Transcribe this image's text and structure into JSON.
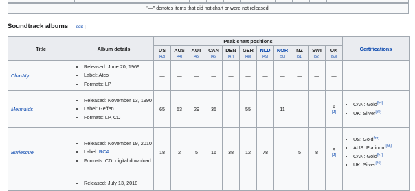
{
  "previous_note": "\"—\" denotes items that did not chart or were not released.",
  "section": {
    "title": "Soundtrack albums",
    "edit_label": "edit"
  },
  "headers": {
    "title": "Title",
    "album_details": "Album details",
    "peak": "Peak chart positions",
    "certifications": "Certifications",
    "countries": [
      {
        "code": "US",
        "ref": "[43]",
        "link": false
      },
      {
        "code": "AUS",
        "ref": "[44]",
        "link": false
      },
      {
        "code": "AUT",
        "ref": "[45]",
        "link": false
      },
      {
        "code": "CAN",
        "ref": "[46]",
        "link": false
      },
      {
        "code": "DEN",
        "ref": "[47]",
        "link": false
      },
      {
        "code": "GER",
        "ref": "[48]",
        "link": false
      },
      {
        "code": "NLD",
        "ref": "[49]",
        "link": true
      },
      {
        "code": "NOR",
        "ref": "[50]",
        "link": true
      },
      {
        "code": "NZ",
        "ref": "[51]",
        "link": false
      },
      {
        "code": "SWI",
        "ref": "[52]",
        "link": false
      },
      {
        "code": "UK",
        "ref": "[53]",
        "link": false
      }
    ]
  },
  "rows": [
    {
      "title": "Chastity",
      "details": [
        {
          "label": "Released:",
          "value": "June 20, 1969"
        },
        {
          "label": "Label:",
          "value": "Atco"
        },
        {
          "label": "Formats:",
          "value": "LP"
        }
      ],
      "peaks": [
        "—",
        "—",
        "—",
        "—",
        "—",
        "—",
        "—",
        "—",
        "—",
        "—",
        "—"
      ],
      "uk_ref": "",
      "certs": []
    },
    {
      "title": "Mermaids",
      "details": [
        {
          "label": "Released:",
          "value": "November 13, 1990"
        },
        {
          "label": "Label:",
          "value": "Geffen"
        },
        {
          "label": "Formats:",
          "value": "LP, CD"
        }
      ],
      "peaks": [
        "65",
        "53",
        "29",
        "35",
        "—",
        "55",
        "—",
        "11",
        "—",
        "—",
        "6"
      ],
      "uk_ref": "[J]",
      "certs": [
        {
          "text": "CAN: Gold",
          "ref": "[54]"
        },
        {
          "text": "UK: Silver",
          "ref": "[20]"
        }
      ]
    },
    {
      "title": "Burlesque",
      "details": [
        {
          "label": "Released:",
          "value": "November 19, 2010"
        },
        {
          "label": "Label:",
          "value": "RCA",
          "link": true
        },
        {
          "label": "Formats:",
          "value": "CD, digital download"
        }
      ],
      "peaks": [
        "18",
        "2",
        "5",
        "16",
        "38",
        "12",
        "78",
        "—",
        "5",
        "8",
        "9"
      ],
      "uk_ref": "[J]",
      "certs": [
        {
          "text": "US: Gold",
          "ref": "[55]"
        },
        {
          "text": "AUS: Platinum",
          "ref": "[56]"
        },
        {
          "text": "CAN: Gold",
          "ref": "[57]"
        },
        {
          "text": "UK: Silver",
          "ref": "[20]"
        }
      ]
    },
    {
      "title": "",
      "details": [
        {
          "label": "Released:",
          "value": "July 13, 2018"
        }
      ],
      "peaks": [
        "",
        "",
        "",
        "",
        "",
        "",
        "",
        "",
        "",
        "",
        ""
      ],
      "uk_ref": "",
      "certs": []
    }
  ]
}
